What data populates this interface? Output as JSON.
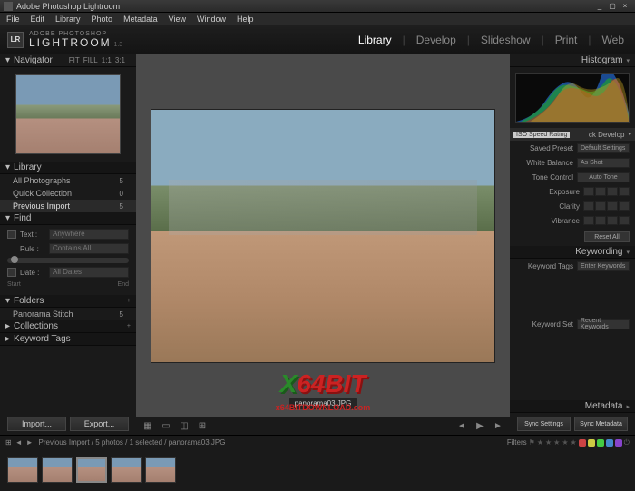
{
  "title": "Adobe Photoshop Lightroom",
  "menus": [
    "File",
    "Edit",
    "Library",
    "Photo",
    "Metadata",
    "View",
    "Window",
    "Help"
  ],
  "brand": {
    "logo": "LR",
    "line1": "ADOBE PHOTOSHOP",
    "line2": "LIGHTROOM",
    "ver": "1.3"
  },
  "modules": [
    "Library",
    "Develop",
    "Slideshow",
    "Print",
    "Web"
  ],
  "activeModule": "Library",
  "nav": {
    "title": "Navigator",
    "opts": [
      "FIT",
      "FILL",
      "1:1",
      "3:1"
    ]
  },
  "library": {
    "title": "Library",
    "items": [
      {
        "label": "All Photographs",
        "count": "5"
      },
      {
        "label": "Quick Collection",
        "count": "0"
      },
      {
        "label": "Previous Import",
        "count": "5"
      }
    ]
  },
  "find": {
    "title": "Find",
    "text": "Text :",
    "textval": "Anywhere",
    "rule": "Rule :",
    "ruleval": "Contains All",
    "date": "Date :",
    "dateval": "All Dates",
    "start": "Start",
    "end": "End"
  },
  "folders": {
    "title": "Folders",
    "items": [
      {
        "label": "Panorama Stitch",
        "count": "5"
      }
    ]
  },
  "collections": {
    "title": "Collections"
  },
  "keywordTags": {
    "title": "Keyword Tags"
  },
  "importBtn": "Import...",
  "exportBtn": "Export...",
  "filename": "panorama03.JPG",
  "histogram": {
    "title": "Histogram"
  },
  "isoBadge": "ISO Speed Rating",
  "quickDev": {
    "title": "ck Develop",
    "preset": {
      "lbl": "Saved Preset",
      "val": "Default Settings"
    },
    "wb": {
      "lbl": "White Balance",
      "val": "As Shot"
    },
    "tone": {
      "lbl": "Tone Control",
      "btn": "Auto Tone"
    },
    "exposure": "Exposure",
    "clarity": "Clarity",
    "vibrance": "Vibrance",
    "reset": "Reset All"
  },
  "keywording": {
    "title": "Keywording",
    "tagsLbl": "Keyword Tags",
    "tagsPlaceholder": "Enter Keywords",
    "setLbl": "Keyword Set",
    "setVal": "Recent Keywords"
  },
  "metadata": {
    "title": "Metadata",
    "sync": "Sync Settings",
    "syncMeta": "Sync Metadata"
  },
  "status": {
    "path": "Previous Import / 5 photos / 1 selected / panorama03.JPG",
    "filters": "Filters"
  },
  "watermark": {
    "x": "X",
    "rest": "64BIT",
    "sub": "x64BITDOWNLOAD.com"
  }
}
